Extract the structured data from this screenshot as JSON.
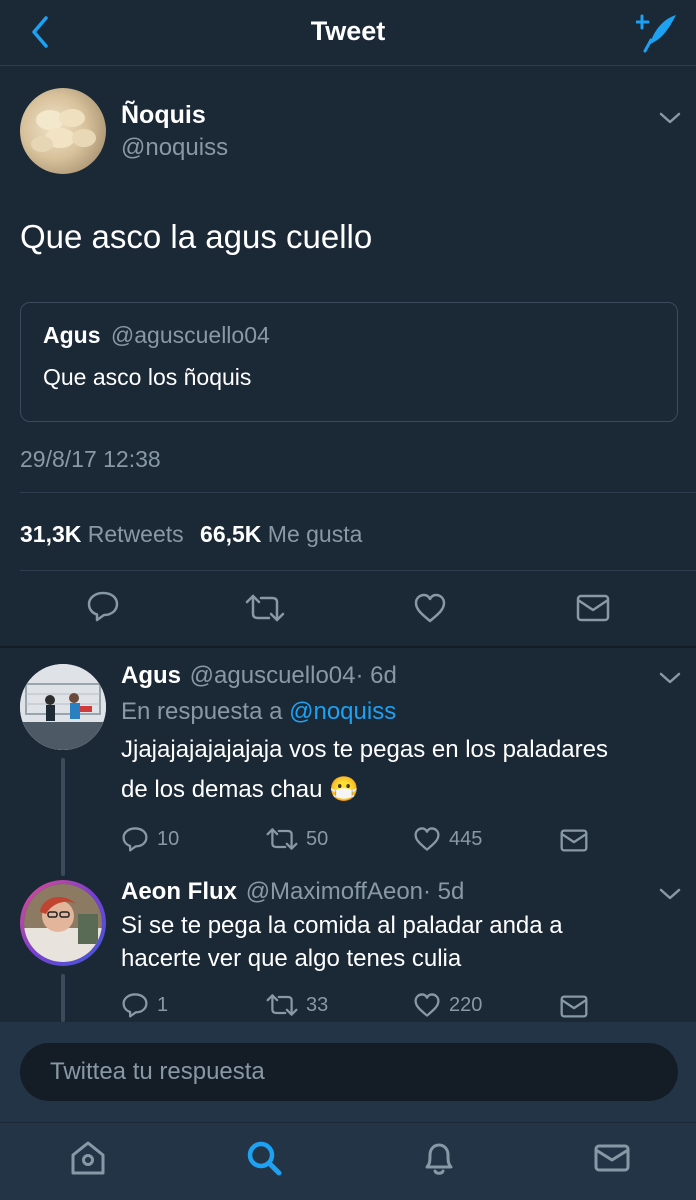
{
  "header": {
    "title": "Tweet"
  },
  "tweet": {
    "author_name": "Ñoquis",
    "author_handle": "@noquiss",
    "text": "Que asco la agus cuello",
    "quoted": {
      "author_name": "Agus",
      "author_handle": "@aguscuello04",
      "text": "Que asco los ñoquis"
    },
    "timestamp": "29/8/17 12:38",
    "stats": {
      "retweets_count": "31,3K",
      "retweets_label": "Retweets",
      "likes_count": "66,5K",
      "likes_label": "Me gusta"
    }
  },
  "replies": [
    {
      "author_name": "Agus",
      "author_handle": "@aguscuello04",
      "time": "· 6d",
      "in_reply_prefix": "En respuesta a",
      "in_reply_handle": "@noquiss",
      "text_line1": "Jjajajajajajajaja vos te pegas en los paladares",
      "text_line2": "de los demas chau",
      "emoji": "😷",
      "reply_count": "10",
      "retweet_count": "50",
      "like_count": "445"
    },
    {
      "author_name": "Aeon Flux",
      "author_handle": "@MaximoffAeon",
      "time": "· 5d",
      "text_line1": "Si se te pega la comida al paladar anda a",
      "text_line2": "hacerte ver que algo tenes culia",
      "reply_count": "1",
      "retweet_count": "33",
      "like_count": "220"
    }
  ],
  "composer": {
    "placeholder": "Twittea tu respuesta"
  },
  "colors": {
    "background": "#1b2836",
    "accent": "#1da1f2",
    "secondary_text": "#8899a6",
    "divider": "#2f3e4e"
  },
  "icons": [
    "back-icon",
    "compose-icon",
    "chevron-down-icon",
    "reply-icon",
    "retweet-icon",
    "like-icon",
    "dm-icon",
    "home-icon",
    "search-icon",
    "notifications-icon",
    "messages-icon"
  ]
}
